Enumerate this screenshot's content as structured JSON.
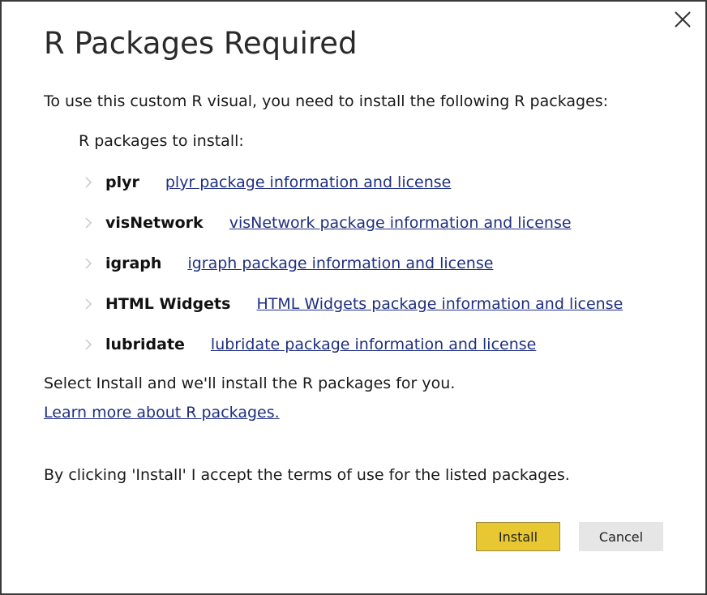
{
  "dialog": {
    "title": "R Packages Required",
    "intro": "To use this custom R visual, you need to install the following R packages:",
    "packages_label": "R packages to install:",
    "packages": [
      {
        "name": "plyr",
        "link": "plyr package information and license"
      },
      {
        "name": "visNetwork",
        "link": "visNetwork package information and license"
      },
      {
        "name": "igraph",
        "link": "igraph package information and license"
      },
      {
        "name": "HTML Widgets",
        "link": "HTML Widgets package information and license"
      },
      {
        "name": "lubridate",
        "link": "lubridate package information and license"
      }
    ],
    "select_install_text": "Select Install and we'll install the R packages for you.",
    "learn_more_link": "Learn more about R packages.",
    "terms_text": "By clicking 'Install' I accept the terms of use for the listed packages.",
    "install_label": "Install",
    "cancel_label": "Cancel",
    "close_icon": "close-icon",
    "chevron_icon": "chevron-right-icon"
  },
  "colors": {
    "install_button": "#e8c832",
    "cancel_button": "#e6e6e6",
    "link": "#1f2f80"
  }
}
